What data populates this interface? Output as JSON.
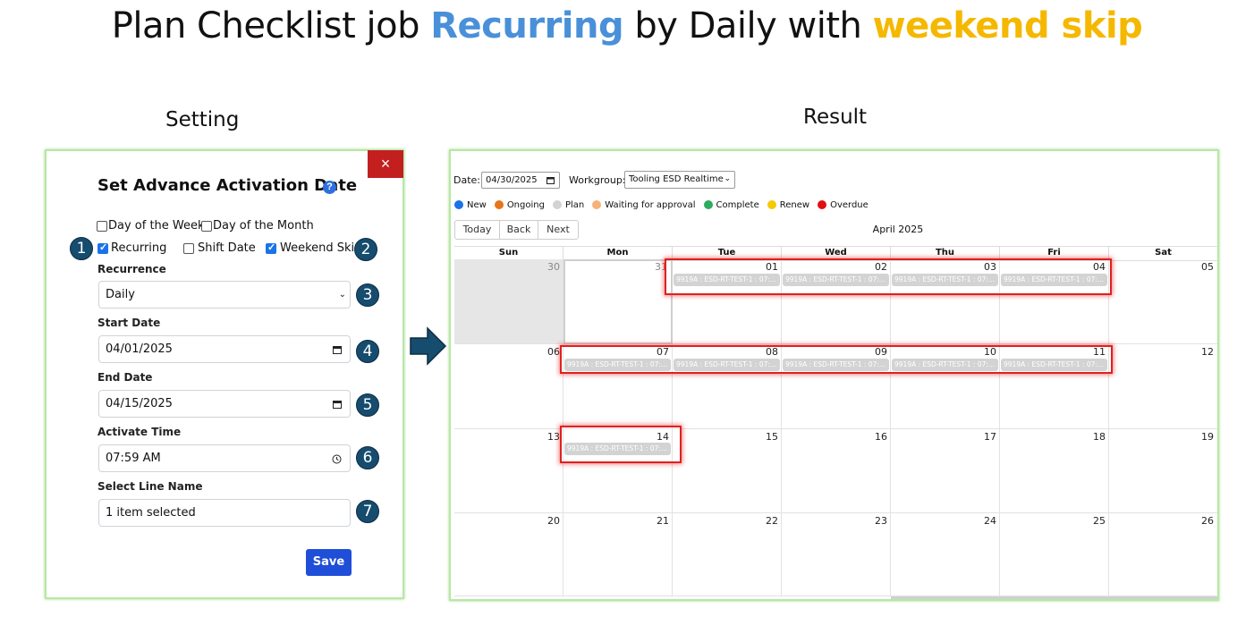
{
  "title": {
    "part1": "Plan Checklist job ",
    "part2": "Recurring",
    "part3": " by Daily",
    "part4": " with ",
    "part5": "weekend skip",
    "accent_blue": "#4a90d9",
    "accent_gold": "#f5b800"
  },
  "headings": {
    "setting": "Setting",
    "result": "Result"
  },
  "dialog": {
    "title": "Set Advance Activation Date",
    "close_icon": "×",
    "help_icon": "?",
    "checkboxes": [
      {
        "label": "Day of the Week",
        "checked": false
      },
      {
        "label": "Day of the Month",
        "checked": false
      },
      {
        "label": "Recurring",
        "checked": true
      },
      {
        "label": "Shift Date",
        "checked": false
      },
      {
        "label": "Weekend Skip",
        "checked": true
      }
    ],
    "recurrence_label": "Recurrence",
    "recurrence_value": "Daily",
    "start_label": "Start Date",
    "start_value": "04/01/2025",
    "end_label": "End Date",
    "end_value": "04/15/2025",
    "time_label": "Activate Time",
    "time_value": "07:59 AM",
    "line_label": "Select Line Name",
    "line_value": "1 item selected",
    "save_label": "Save",
    "badges": [
      "1",
      "2",
      "3",
      "4",
      "5",
      "6",
      "7"
    ]
  },
  "calendar": {
    "date_label": "Date:",
    "date_value": "04/30/2025",
    "workgroup_label": "Workgroup:",
    "workgroup_value": "Tooling ESD Realtime",
    "legend": [
      {
        "label": "New",
        "color": "#1a73e8"
      },
      {
        "label": "Ongoing",
        "color": "#e8741a"
      },
      {
        "label": "Plan",
        "color": "#d3d3d3"
      },
      {
        "label": "Waiting for approval",
        "color": "#f7b27a"
      },
      {
        "label": "Complete",
        "color": "#2eab5c"
      },
      {
        "label": "Renew",
        "color": "#f5c800"
      },
      {
        "label": "Overdue",
        "color": "#e01010"
      }
    ],
    "nav": {
      "today": "Today",
      "back": "Back",
      "next": "Next"
    },
    "month_title": "April 2025",
    "days_of_week": [
      "Sun",
      "Mon",
      "Tue",
      "Wed",
      "Thu",
      "Fri",
      "Sat"
    ],
    "weeks": [
      [
        "30",
        "31",
        "01",
        "02",
        "03",
        "04",
        "05"
      ],
      [
        "06",
        "07",
        "08",
        "09",
        "10",
        "11",
        "12"
      ],
      [
        "13",
        "14",
        "15",
        "16",
        "17",
        "18",
        "19"
      ],
      [
        "20",
        "21",
        "22",
        "23",
        "24",
        "25",
        "26"
      ]
    ],
    "event_text": "9919A : ESD-RT-TEST-1 : 07:..."
  }
}
